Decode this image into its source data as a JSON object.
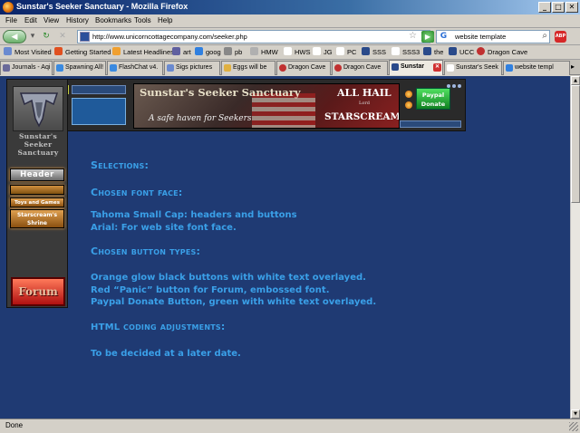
{
  "window": {
    "title": "Sunstar's Seeker Sanctuary - Mozilla Firefox",
    "minimize": "_",
    "maximize": "□",
    "close": "✕"
  },
  "menu": [
    "File",
    "Edit",
    "View",
    "History",
    "Bookmarks",
    "Tools",
    "Help"
  ],
  "nav": {
    "url": "http://www.unicorncottagecompany.com/seeker.php",
    "search_value": "website template",
    "back_glyph": "◀",
    "forward_glyph": "▶",
    "reload_glyph": "↻",
    "stop_glyph": "✕",
    "home_glyph": "⌂",
    "star_glyph": "☆",
    "go_glyph": "▶",
    "search_glyph": "🔍",
    "adblock": "ABP"
  },
  "bookmarks": [
    {
      "label": "Most Visited",
      "color": "#6a8ad0"
    },
    {
      "label": "Getting Started",
      "color": "#e05020"
    },
    {
      "label": "Latest Headlines",
      "color": "#f0a030"
    },
    {
      "label": "art",
      "color": "#6060a0"
    },
    {
      "label": "goog",
      "color": "#3080e0"
    },
    {
      "label": "pb",
      "color": "#888888"
    },
    {
      "label": "HMW",
      "color": "#b0b0b0"
    },
    {
      "label": "HWS",
      "color": "#ffffff"
    },
    {
      "label": "JG",
      "color": "#ffffff"
    },
    {
      "label": "PC",
      "color": "#2a4a8a"
    },
    {
      "label": "SSS",
      "color": "#2a4a8a"
    },
    {
      "label": "SSS3",
      "color": "#ffffff"
    },
    {
      "label": "the",
      "color": "#2a4a8a"
    },
    {
      "label": "UCC",
      "color": "#2a4a8a"
    },
    {
      "label": "Dragon Cave",
      "color": "#c03030"
    }
  ],
  "tabs": [
    {
      "label": "Journals - Aqi",
      "color": "#6a6a9a",
      "active": false
    },
    {
      "label": "Spawning All!",
      "color": "#3a8ae0",
      "active": false
    },
    {
      "label": "FlashChat v4.",
      "color": "#3a8ae0",
      "active": false
    },
    {
      "label": "Sigs pictures",
      "color": "#6a8ad0",
      "active": false
    },
    {
      "label": "Eggs will be",
      "color": "#e0b040",
      "active": false
    },
    {
      "label": "Dragon Cave",
      "color": "#c03030",
      "active": false
    },
    {
      "label": "Dragon Cave",
      "color": "#c03030",
      "active": false
    },
    {
      "label": "Sunstar",
      "color": "#2a4a8a",
      "active": true
    },
    {
      "label": "Sunstar's Seek",
      "color": "#ffffff",
      "active": false
    },
    {
      "label": "website templ",
      "color": "#3080e0",
      "active": false
    }
  ],
  "site": {
    "side_title": "Sunstar's Seeker Sanctuary",
    "banner_title": "Sunstar's Seeker Sanctuary",
    "banner_subtitle": "A safe haven for Seekers",
    "all_hail": "ALL HAIL",
    "lord": "Lord",
    "starscream": "STARSCREAM",
    "paypal_line1": "Paypal",
    "paypal_line2": "Donate",
    "nav": {
      "header": "Header",
      "toys": "Toys and Games",
      "shrine": "Starscream's Shrine",
      "forum": "Forum"
    }
  },
  "content": {
    "selections": "Selections:",
    "font_heading": "Chosen font face:",
    "font_line1": "Tahoma Small Cap: headers and buttons",
    "font_line2": "Arial: For web site font face.",
    "button_heading": "Chosen button types:",
    "button_line1": "Orange glow black buttons with white text overlayed.",
    "button_line2": "Red “Panic” button for Forum, embossed font.",
    "button_line3": "Paypal Donate Button, green with white text overlayed.",
    "html_heading_a": "HTML",
    "html_heading_b": "coding adjustments:",
    "html_line1": "To be decided at a later date."
  },
  "status": "Done"
}
